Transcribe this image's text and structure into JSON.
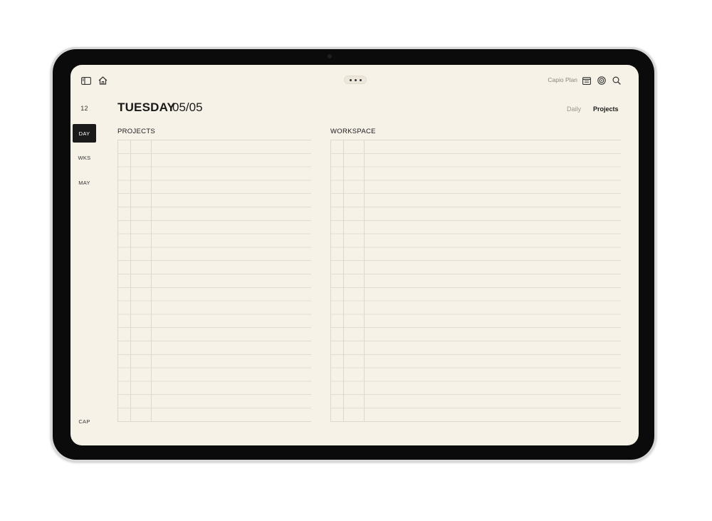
{
  "topbar": {
    "app_name": "Capio Plan",
    "icons": [
      "sidebar-icon",
      "home-icon",
      "more-icon",
      "calendar-icon",
      "target-icon",
      "search-icon"
    ]
  },
  "rail": {
    "number": "12",
    "items": [
      {
        "label": "DAY",
        "active": true
      },
      {
        "label": "WKS",
        "active": false
      },
      {
        "label": "MAY",
        "active": false
      }
    ],
    "bottom": "CAP"
  },
  "header": {
    "weekday": "TUESDAY",
    "date": "05/05"
  },
  "tabs": [
    {
      "label": "Daily",
      "active": false
    },
    {
      "label": "Projects",
      "active": true
    }
  ],
  "sections": {
    "projects": "PROJECTS",
    "workspace": "WORKSPACE"
  },
  "colors": {
    "paper": "#f6f2e7",
    "ink": "#1a1a1a",
    "grid": "#ddd8cb",
    "muted": "#9a968d"
  }
}
